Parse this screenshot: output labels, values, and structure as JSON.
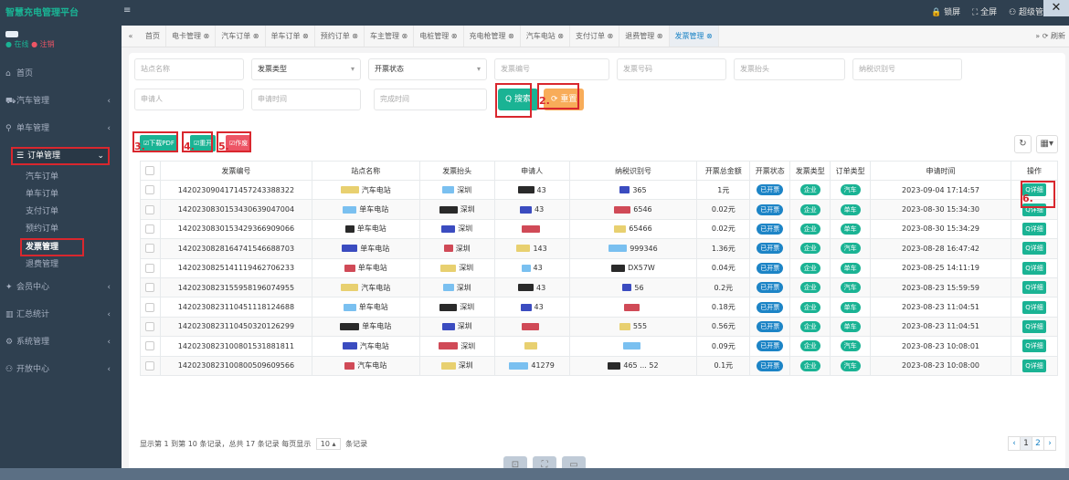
{
  "sidebar": {
    "brand": "智慧充电管理平台",
    "status_online": "● 在线",
    "status_logout": "● 注销",
    "items": [
      {
        "icon": "⌂",
        "label": "首页",
        "chev": ""
      },
      {
        "icon": "⛟",
        "label": "汽车管理",
        "chev": "‹"
      },
      {
        "icon": "⚲",
        "label": "单车管理",
        "chev": "‹"
      },
      {
        "icon": "☰",
        "label": "订单管理",
        "chev": "⌄"
      }
    ],
    "submenu": [
      "汽车订单",
      "单车订单",
      "支付订单",
      "预约订单",
      "发票管理",
      "退费管理"
    ],
    "items_after": [
      {
        "icon": "✦",
        "label": "会员中心",
        "chev": "‹"
      },
      {
        "icon": "▥",
        "label": "汇总统计",
        "chev": "‹"
      },
      {
        "icon": "⚙",
        "label": "系统管理",
        "chev": "‹"
      },
      {
        "icon": "⚇",
        "label": "开放中心",
        "chev": "‹"
      }
    ]
  },
  "topbar": {
    "menu_icon": "≡",
    "lock": "🔒 锁屏",
    "fullscreen": "⛶ 全屏",
    "user": "⚇ 超级管理员",
    "close": "✕"
  },
  "tabs": {
    "back": "«",
    "items": [
      "首页",
      "电卡管理 ⊗",
      "汽车订单 ⊗",
      "单车订单 ⊗",
      "预约订单 ⊗",
      "车主管理 ⊗",
      "电桩管理 ⊗",
      "充电枪管理 ⊗",
      "汽车电站 ⊗",
      "支付订单 ⊗",
      "退费管理 ⊗",
      "发票管理 ⊗"
    ],
    "forward": "»",
    "refresh": "⟳ 刷新"
  },
  "filters": {
    "station": "站点名称",
    "invoice_type": "发票类型",
    "issue_status": "开票状态",
    "invoice_code": "发票编号",
    "invoice_number": "发票号码",
    "invoice_title": "发票抬头",
    "tax_id": "纳税识别号",
    "applicant": "申请人",
    "apply_time": "申请时间",
    "finish_time": "完成时间",
    "search_btn": "Q 搜索",
    "reset_btn": "⟳ 重置",
    "caret": "▾"
  },
  "annotations": {
    "n2": "2.",
    "n3": "3.",
    "n4": "4.",
    "n5": "5.",
    "n6": "6."
  },
  "toolbar": {
    "pdf": "☑下载PDF",
    "open": "☑重开",
    "void": "☑作废",
    "refresh_icon": "↻",
    "columns_icon": "▦▾"
  },
  "table": {
    "headers": [
      "",
      "发票编号",
      "站点名称",
      "发票抬头",
      "申请人",
      "纳税识别号",
      "开票总金额",
      "开票状态",
      "发票类型",
      "订单类型",
      "申请时间",
      "操作"
    ],
    "rows": [
      {
        "code": "1420230904171457243388322",
        "station": "汽车电站",
        "title": "深圳",
        "applicant": "43",
        "tax": "365",
        "amount": "1元",
        "status": "已开票",
        "type": "企业",
        "order": "汽车",
        "time": "2023-09-04 17:14:57"
      },
      {
        "code": "1420230830153430639047004",
        "station": "单车电站",
        "title": "深圳",
        "applicant": "43",
        "tax": "6546",
        "amount": "0.02元",
        "status": "已开票",
        "type": "企业",
        "order": "单车",
        "time": "2023-08-30 15:34:30"
      },
      {
        "code": "1420230830153429366909066",
        "station": "单车电站",
        "title": "深圳",
        "applicant": "",
        "tax": "65466",
        "amount": "0.02元",
        "status": "已开票",
        "type": "企业",
        "order": "单车",
        "time": "2023-08-30 15:34:29"
      },
      {
        "code": "1420230828164741546688703",
        "station": "单车电站",
        "title": "深圳",
        "applicant": "143",
        "tax": "999346",
        "amount": "1.36元",
        "status": "已开票",
        "type": "企业",
        "order": "汽车",
        "time": "2023-08-28 16:47:42"
      },
      {
        "code": "1420230825141119462706233",
        "station": "单车电站",
        "title": "深圳",
        "applicant": "43",
        "tax": "DX57W",
        "amount": "0.04元",
        "status": "已开票",
        "type": "企业",
        "order": "单车",
        "time": "2023-08-25 14:11:19"
      },
      {
        "code": "1420230823155958196074955",
        "station": "汽车电站",
        "title": "深圳",
        "applicant": "43",
        "tax": "56",
        "amount": "0.2元",
        "status": "已开票",
        "type": "企业",
        "order": "汽车",
        "time": "2023-08-23 15:59:59"
      },
      {
        "code": "1420230823110451118124688",
        "station": "单车电站",
        "title": "深圳",
        "applicant": "43",
        "tax": "",
        "amount": "0.18元",
        "status": "已开票",
        "type": "企业",
        "order": "单车",
        "time": "2023-08-23 11:04:51"
      },
      {
        "code": "1420230823110450320126299",
        "station": "单车电站",
        "title": "深圳",
        "applicant": "",
        "tax": "555",
        "amount": "0.56元",
        "status": "已开票",
        "type": "企业",
        "order": "单车",
        "time": "2023-08-23 11:04:51"
      },
      {
        "code": "1420230823100801531881811",
        "station": "汽车电站",
        "title": "深圳",
        "applicant": "",
        "tax": "",
        "amount": "0.09元",
        "status": "已开票",
        "type": "企业",
        "order": "汽车",
        "time": "2023-08-23 10:08:01"
      },
      {
        "code": "1420230823100800509609566",
        "station": "汽车电站",
        "title": "深圳",
        "applicant": "41279",
        "tax": "465 ... 52",
        "amount": "0.1元",
        "status": "已开票",
        "type": "企业",
        "order": "汽车",
        "time": "2023-08-23 10:08:00"
      }
    ],
    "detail_btn": "Q详细"
  },
  "footer": {
    "summary": "显示第 1 到第 10 条记录，总共 17 条记录 每页显示",
    "page_size": "10 ▴",
    "suffix": "条记录",
    "pager": [
      "‹",
      "1",
      "2",
      "›"
    ]
  },
  "colors": {
    "accent": "#1ab394",
    "highlight": "#d9272e",
    "sidebar_bg": "#2f4050",
    "blue": "#1c84c6"
  }
}
